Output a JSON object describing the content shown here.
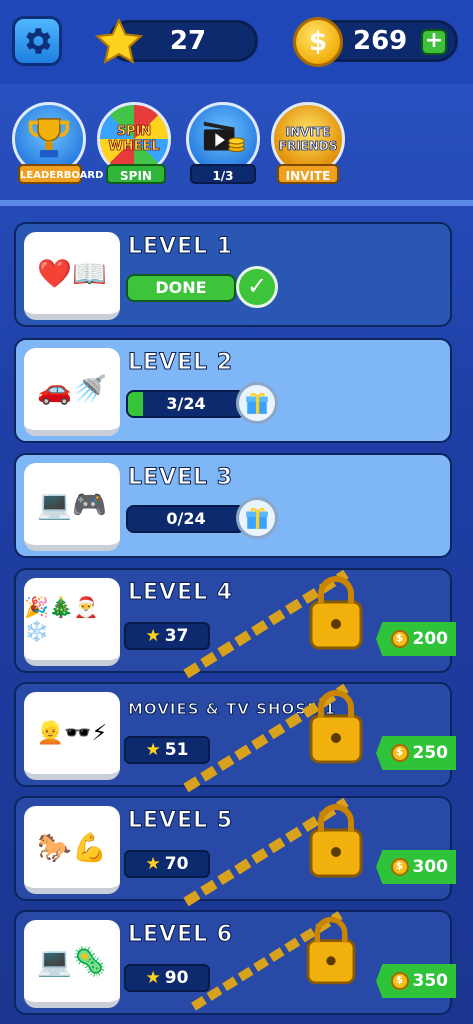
{
  "header": {
    "stars": "27",
    "coins": "269",
    "plus_label": "+",
    "coin_symbol": "$"
  },
  "features": [
    {
      "label": "LEADERBOARD",
      "icon": "trophy-icon"
    },
    {
      "label": "SPIN",
      "title_line1": "SPIN",
      "title_line2": "WHEEL",
      "icon": "spin-wheel-icon"
    },
    {
      "label": "1/3",
      "icon": "video-coins-icon"
    },
    {
      "label": "INVITE",
      "title_line1": "INVITE",
      "title_line2": "FRIENDS",
      "icon": "invite-friends-icon"
    }
  ],
  "levels": [
    {
      "title": "LEVEL 1",
      "emoji": "❤️📖",
      "status": "DONE"
    },
    {
      "title": "LEVEL 2",
      "emoji": "🚗🚿",
      "progress": "3/24",
      "progress_value": 0.125
    },
    {
      "title": "LEVEL 3",
      "emoji": "💻🎮",
      "progress": "0/24",
      "progress_value": 0
    },
    {
      "title": "LEVEL 4",
      "emoji": "🎉🎄🎅❄️",
      "stars": "37",
      "cost": "200"
    },
    {
      "title": "MOVIES & TV SHOSE 1",
      "emoji": "👱🕶️⚡",
      "stars": "51",
      "cost": "250"
    },
    {
      "title": "LEVEL 5",
      "emoji": "🐎💪",
      "stars": "70",
      "cost": "300"
    },
    {
      "title": "LEVEL 6",
      "emoji": "💻🦠",
      "stars": "90",
      "cost": "350"
    }
  ],
  "colors": {
    "accent": "#1f47b8",
    "green": "#36c43a",
    "gold": "#f2b00c"
  }
}
